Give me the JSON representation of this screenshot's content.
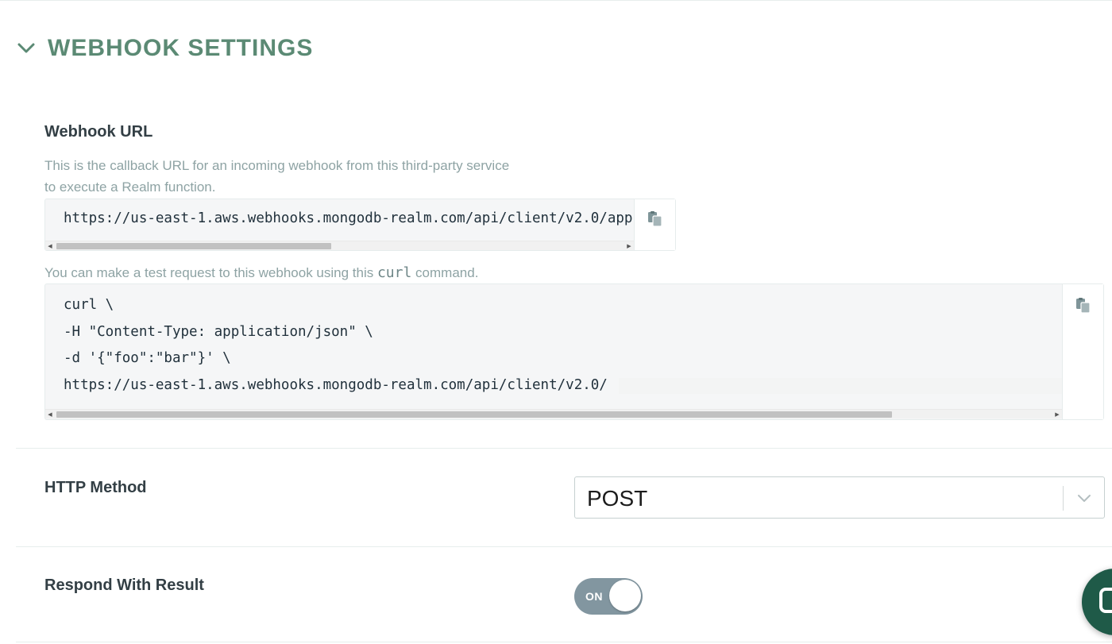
{
  "section": {
    "title": "WEBHOOK SETTINGS",
    "toggle_icon": "chevron-down-icon"
  },
  "webhook_url": {
    "label": "Webhook URL",
    "help_line1": "This is the callback URL for an incoming webhook from this third-party service",
    "help_line2": "to execute a Realm function.",
    "url": "https://us-east-1.aws.webhooks.mongodb-realm.com/api/client/v2.0/app",
    "copy_icon": "copy-icon"
  },
  "curl": {
    "help_prefix": "You can make a test request to this webhook using this ",
    "help_code": "curl",
    "help_suffix": " command.",
    "lines": [
      "curl \\",
      "-H \"Content-Type: application/json\" \\",
      "-d '{\"foo\":\"bar\"}' \\",
      "https://us-east-1.aws.webhooks.mongodb-realm.com/api/client/v2.0/"
    ],
    "copy_icon": "copy-icon"
  },
  "http_method": {
    "label": "HTTP Method",
    "selected": "POST"
  },
  "respond_with_result": {
    "label": "Respond With Result",
    "toggle_text": "ON",
    "state": "on"
  },
  "colors": {
    "accent": "#5b8a74",
    "toggle_on": "#8296a0",
    "chat_widget": "#1f5a48"
  }
}
